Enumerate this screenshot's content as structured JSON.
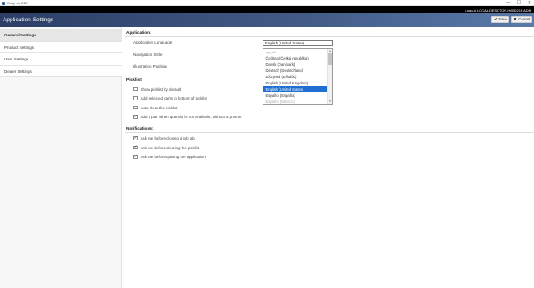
{
  "window": {
    "title": "Snap on EPC",
    "controls": [
      "—",
      "☐",
      "✕"
    ]
  },
  "header": {
    "user": "Logout LOCAL DESKTOP-H65D21F.ADM",
    "page_title": "Application Settings",
    "save_label": "Save",
    "cancel_label": "Cancel",
    "save_icon": "✔",
    "cancel_icon": "✖"
  },
  "sidebar": {
    "items": [
      {
        "label": "General Settings",
        "active": true
      },
      {
        "label": "Product Settings",
        "active": false
      },
      {
        "label": "User Settings",
        "active": false
      },
      {
        "label": "Dealer Settings",
        "active": false
      }
    ]
  },
  "application": {
    "section_title": "Application:",
    "language_label": "Application Language",
    "language_value": "English (United States)",
    "navigation_label": "Navigation Style",
    "illustration_label": "Illustration Position",
    "language_options": [
      {
        "label": "العربية",
        "state": "faded"
      },
      {
        "label": "Čeština (Česká republika)",
        "state": "normal"
      },
      {
        "label": "Dansk (Danmark)",
        "state": "normal"
      },
      {
        "label": "Deutsch (Deutschland)",
        "state": "normal"
      },
      {
        "label": "Ελληνικά (Ελλάδα)",
        "state": "normal"
      },
      {
        "label": "English (United Kingdom)",
        "state": "normal"
      },
      {
        "label": "English (United States)",
        "state": "selected"
      },
      {
        "label": "Español (España)",
        "state": "normal"
      },
      {
        "label": "Español (México)",
        "state": "faded"
      }
    ]
  },
  "picklist": {
    "section_title": "Picklist:",
    "options": [
      {
        "label": "Show picklist by default",
        "checked": false
      },
      {
        "label": "Add selected parts to bottom of picklist",
        "checked": false
      },
      {
        "label": "Auto-clear the picklist",
        "checked": false
      },
      {
        "label": "Add 1 part when quantity is not available, without a prompt",
        "checked": true
      }
    ]
  },
  "notifications": {
    "section_title": "Notifications:",
    "options": [
      {
        "label": "Ask me before closing a job tab",
        "checked": true
      },
      {
        "label": "Ask me before clearing the picklist",
        "checked": true
      },
      {
        "label": "Ask me before quitting the application",
        "checked": true
      }
    ]
  },
  "colors": {
    "header_dark": "#2c3e66",
    "header_light": "#5a7aa8",
    "selection": "#1f6fd1"
  }
}
